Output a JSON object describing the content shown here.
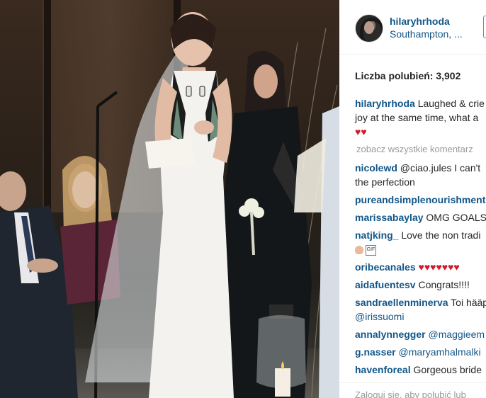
{
  "post": {
    "username": "hilaryhrhoda",
    "location": "Southampton, ...",
    "likes_label": "Liczba polubień:",
    "likes_count": "3,902"
  },
  "caption": {
    "user": "hilaryhrhoda",
    "line1": "Laughed & crie",
    "line2": "joy at the same time, what a",
    "hearts": "♥♥"
  },
  "view_all": "zobacz wszystkie komentarz",
  "comments": [
    {
      "user": "nicolewd",
      "text": "@ciao.jules I can't",
      "text2": "the perfection"
    },
    {
      "user": "pureandsimplenourishment",
      "text": ""
    },
    {
      "user": "marissabaylay",
      "text": "OMG GOALS"
    },
    {
      "user": "natjking_",
      "text": "Love the non tradi",
      "text2": "GIF"
    },
    {
      "user": "oribecanales",
      "text": "♥♥♥♥♥♥♥"
    },
    {
      "user": "aidafuentesv",
      "text": "Congrats!!!!"
    },
    {
      "user": "sandraellenminerva",
      "text": "Toi hääp",
      "text2": "@irissuomi"
    },
    {
      "user": "annalynnegger",
      "text": "@maggieem"
    },
    {
      "user": "g.nasser",
      "text": "@maryamhalmalki"
    },
    {
      "user": "havenforeal",
      "text": "Gorgeous bride"
    }
  ],
  "footer": {
    "login_prompt": "Zaloguj się, aby polubić lub"
  },
  "colors": {
    "link": "#125688",
    "text": "#262626",
    "muted": "#999999",
    "heart": "#d11a2a"
  }
}
